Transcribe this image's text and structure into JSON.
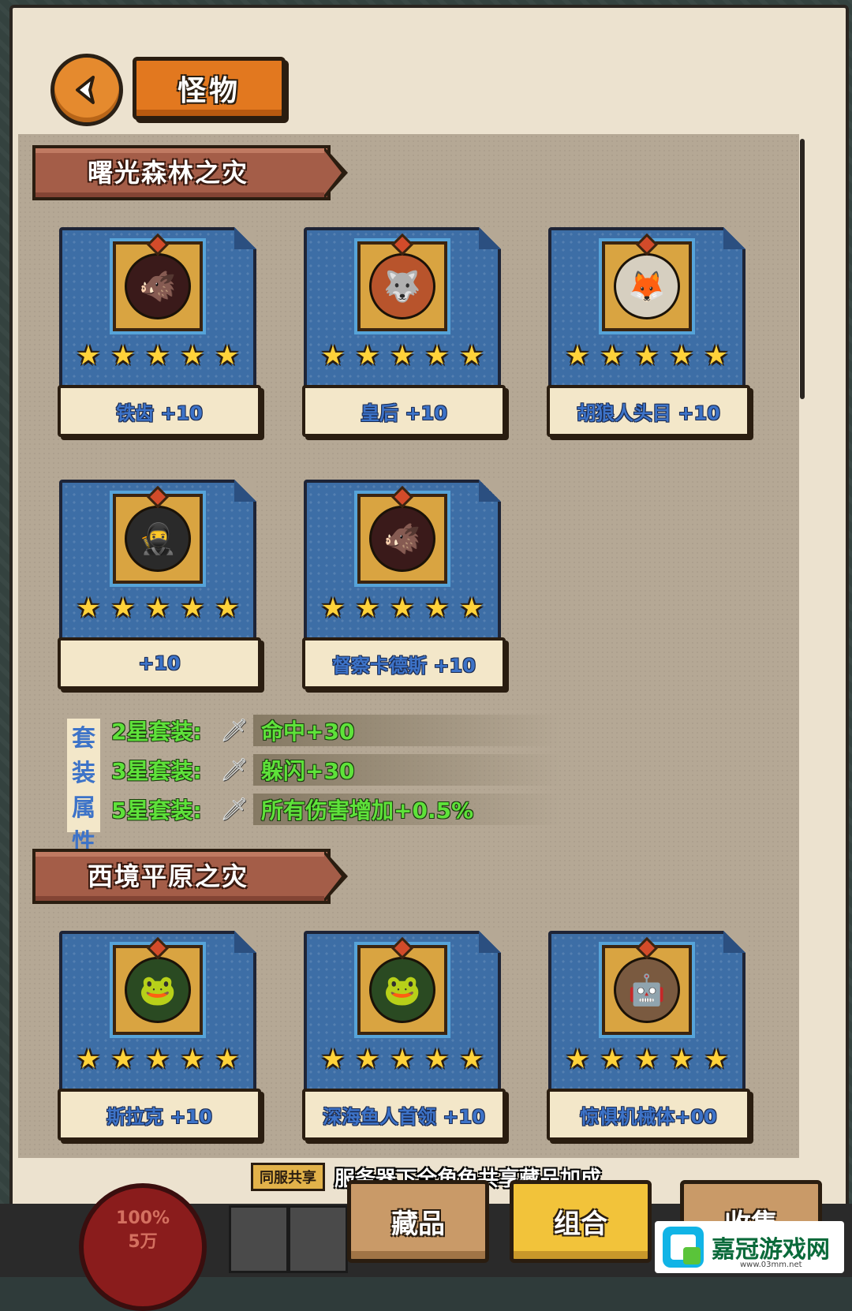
{
  "header": {
    "title": "怪物"
  },
  "sections": [
    {
      "name": "曙光森林之灾",
      "cards": [
        {
          "label": "铁齿 +10",
          "stars": 5,
          "face": "🐗"
        },
        {
          "label": "皇后 +10",
          "stars": 5,
          "face": "🐺"
        },
        {
          "label": "胡狼人头目 +10",
          "stars": 5,
          "face": "🦊"
        },
        {
          "label": "+10",
          "stars": 5,
          "face": "🥷"
        },
        {
          "label": "督察卡德斯 +10",
          "stars": 5,
          "face": "🐗"
        }
      ],
      "set_bonus": {
        "title_chars": [
          "套",
          "装",
          "属",
          "性"
        ],
        "rows": [
          {
            "label": "2星套装:",
            "value": "命中+30"
          },
          {
            "label": "3星套装:",
            "value": "躲闪+30"
          },
          {
            "label": "5星套装:",
            "value": "所有伤害增加+0.5%"
          }
        ]
      }
    },
    {
      "name": "西境平原之灾",
      "cards": [
        {
          "label": "斯拉克 +10",
          "stars": 5,
          "face": "🐸"
        },
        {
          "label": "深海鱼人首领 +10",
          "stars": 5,
          "face": "🐸"
        },
        {
          "label": "惊惧机械体+00",
          "stars": 5,
          "face": "🤖"
        }
      ]
    }
  ],
  "share_bar": {
    "tag": "同服共享",
    "text": "服务器下全角色共享藏品加成"
  },
  "bottom": {
    "hp_percent": "100%",
    "hp_amount": "5万",
    "tabs": [
      "藏品",
      "组合",
      "收集"
    ]
  },
  "watermark": {
    "text": "嘉冠游戏网",
    "url": "www.03mm.net"
  },
  "colors": {
    "card_blue": "#3d6ea6",
    "ribbon": "#a45d48",
    "accent_orange": "#e2781f",
    "bonus_green": "#5ee23a",
    "label_blue": "#3d73c8"
  }
}
